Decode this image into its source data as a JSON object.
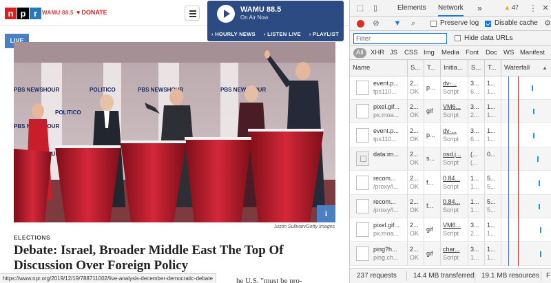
{
  "page": {
    "logo_letters": [
      "n",
      "p",
      "r"
    ],
    "station_logo": "WAMU 88.5",
    "donate_label": "DONATE",
    "player": {
      "station": "WAMU 88.5",
      "subtitle": "On Air Now",
      "links": [
        "HOURLY NEWS",
        "LISTEN LIVE",
        "PLAYLIST"
      ]
    },
    "live_badge": "LIVE",
    "info_icon_glyph": "i",
    "photo_credit": "Justin Sullivan/Getty Images",
    "section": "ELECTIONS",
    "headline": "Debate: Israel, Broader Middle East The Top Of Discussion Over Foreign Policy",
    "body_snippet": "he U.S. \"must be pro-",
    "status_url": "https://www.npr.org/2019/12/19/788711002/live-analysis-december-democratic-debate",
    "photo_signs": [
      "POLITICO",
      "PBS NEWSHOUR"
    ]
  },
  "devtools": {
    "tabs": [
      "Elements",
      "Network"
    ],
    "active_tab": "Network",
    "more_tabs": "»",
    "warnings": "47",
    "menu_glyph": "⋮",
    "close_glyph": "✕",
    "preserve_log": {
      "label": "Preserve log",
      "checked": false
    },
    "disable_cache": {
      "label": "Disable cache",
      "checked": true
    },
    "filter_placeholder": "Filter",
    "hide_data_urls": {
      "label": "Hide data URLs",
      "checked": false
    },
    "types": [
      "All",
      "XHR",
      "JS",
      "CSS",
      "Img",
      "Media",
      "Font",
      "Doc",
      "WS",
      "Manifest"
    ],
    "active_type": "All",
    "columns": [
      "Name",
      "S...",
      "T...",
      "Initia...",
      "S...",
      "T...",
      "Waterfall"
    ],
    "sort_glyph": "▲",
    "rows": [
      {
        "name": "event.p...",
        "path": "tps110...",
        "status": "2...",
        "status2": "OK",
        "type": "p...",
        "init": "dv-...",
        "init2": "Script",
        "size": "3...",
        "size2": "6...",
        "time": "1...",
        "time2": "1...",
        "thumb": "img",
        "init_link": true,
        "wf": 264
      },
      {
        "name": "pixel.gif...",
        "path": "px.moa...",
        "status": "2...",
        "status2": "OK",
        "type": "gif",
        "init": "VM6...",
        "init2": "Script",
        "size": "3...",
        "size2": "2...",
        "time": "1...",
        "time2": "1...",
        "thumb": "img",
        "init_link": true,
        "wf": 266
      },
      {
        "name": "event.p...",
        "path": "tps110...",
        "status": "2...",
        "status2": "OK",
        "type": "p...",
        "init": "dv-...",
        "init2": "Script",
        "size": "3...",
        "size2": "6...",
        "time": "1...",
        "time2": "1...",
        "thumb": "img",
        "init_link": true,
        "wf": 266
      },
      {
        "name": "data:im...",
        "path": "",
        "status": "2...",
        "status2": "OK",
        "type": "s...",
        "init": "osd.j...",
        "init2": "Script",
        "size": "(...",
        "size2": "(...",
        "time": "0...",
        "time2": "",
        "thumb": "data",
        "init_link": true,
        "wf": 272
      },
      {
        "name": "recom...",
        "path": "/proxy/l...",
        "status": "2...",
        "status2": "OK",
        "type": "f...",
        "init": "0.84...",
        "init2": "Script",
        "size": "1...",
        "size2": "1...",
        "time": "5...",
        "time2": "5...",
        "thumb": "img",
        "init_link": true,
        "wf": 274
      },
      {
        "name": "recom...",
        "path": "/proxy/l...",
        "status": "2...",
        "status2": "OK",
        "type": "f...",
        "init": "0.84...",
        "init2": "Script",
        "size": "1...",
        "size2": "1...",
        "time": "5...",
        "time2": "5...",
        "thumb": "img",
        "init_link": true,
        "wf": 274
      },
      {
        "name": "pixel.gif...",
        "path": "px.moa...",
        "status": "2...",
        "status2": "OK",
        "type": "gif",
        "init": "VM6...",
        "init2": "Script",
        "size": "3...",
        "size2": "2...",
        "time": "1...",
        "time2": "1...",
        "thumb": "img",
        "init_link": true,
        "wf": 276
      },
      {
        "name": "ping?h...",
        "path": "ping.ch...",
        "status": "2...",
        "status2": "OK",
        "type": "gif",
        "init": "char...",
        "init2": "Script",
        "size": "3...",
        "size2": "1...",
        "time": "1...",
        "time2": "1...",
        "thumb": "img",
        "init_link": true,
        "wf": 276
      }
    ],
    "status_bar": [
      "237 requests",
      "14.4 MB transferred",
      "19.1 MB resources",
      "F"
    ]
  },
  "colors": {
    "npr_red": "#d62021",
    "player_blue": "#2b4b82",
    "live_blue": "#4a80c3",
    "dt_accent": "#1a73e8",
    "record_red": "#d93025"
  }
}
